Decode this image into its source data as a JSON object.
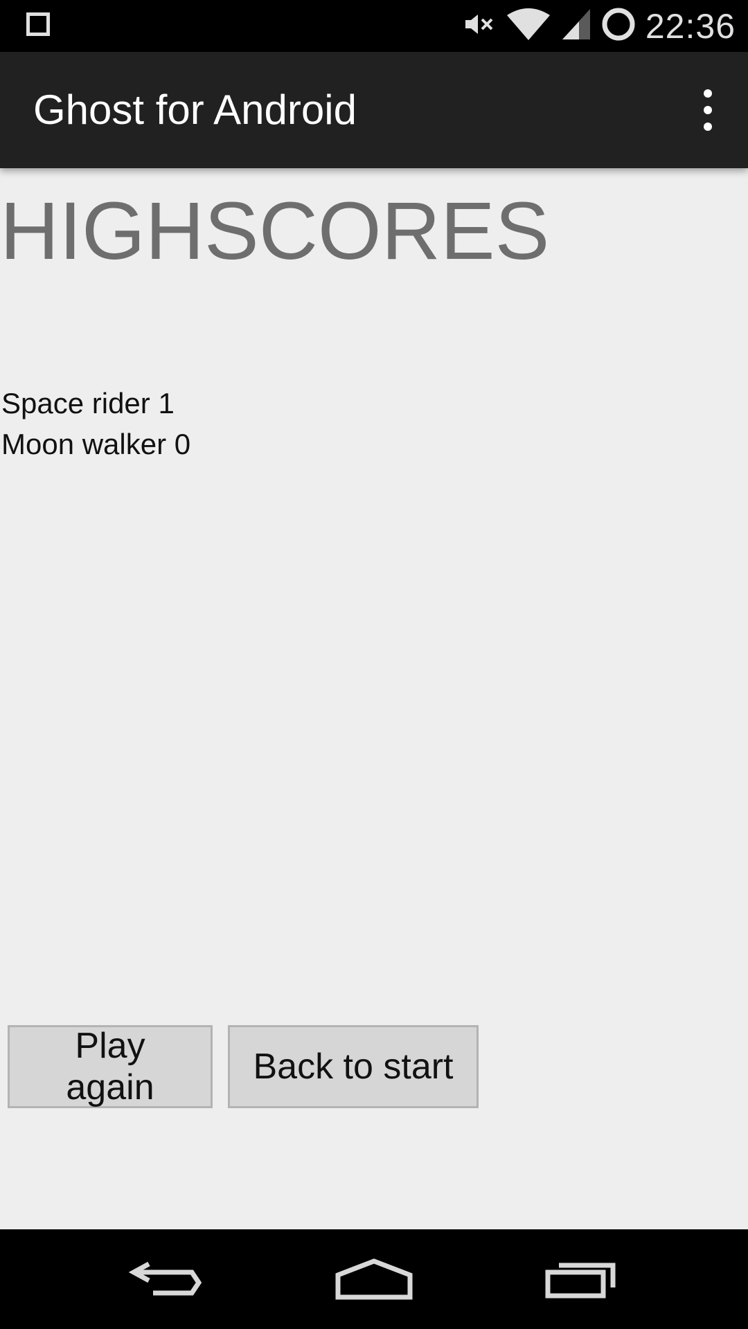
{
  "status_bar": {
    "time": "22:36",
    "icons": [
      "notification-square-icon",
      "mute-icon",
      "wifi-icon",
      "signal-icon",
      "sync-circle-icon"
    ]
  },
  "action_bar": {
    "title": "Ghost for Android",
    "menu_icon": "overflow-menu-icon"
  },
  "main": {
    "title": "HIGHSCORES",
    "scores": [
      {
        "text": "Space rider 1"
      },
      {
        "text": "Moon walker 0"
      }
    ],
    "buttons": {
      "play_again": "Play again",
      "back_to_start": "Back to start"
    }
  },
  "nav_bar": {
    "icons": [
      "back-icon",
      "home-icon",
      "recents-icon"
    ]
  },
  "colors": {
    "background": "#eeeeee",
    "action_bar": "#212121",
    "title_gray": "#6e6e6e",
    "button_bg": "#d6d6d6"
  }
}
